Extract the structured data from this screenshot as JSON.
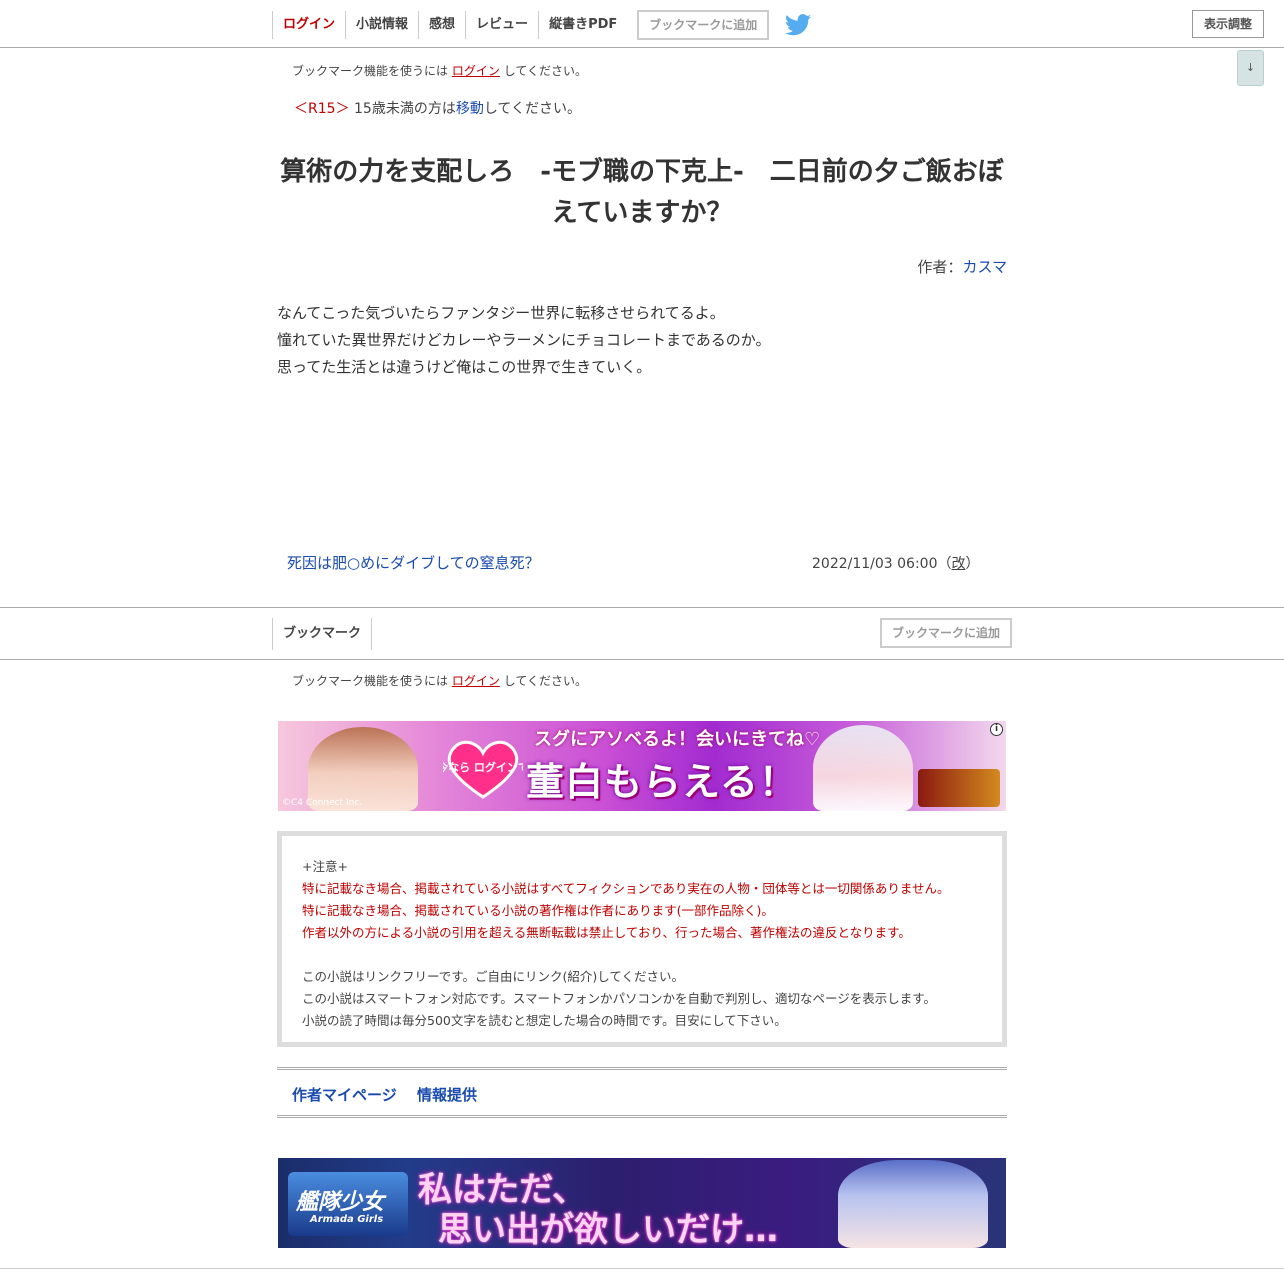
{
  "nav": {
    "items": [
      "ログイン",
      "小説情報",
      "感想",
      "レビュー",
      "縦書きPDF"
    ],
    "bookmark_add": "ブックマークに追加",
    "display_settings": "表示調整",
    "scroll_arrow": "↓"
  },
  "bookmark_notice": {
    "prefix": "ブックマーク機能を使うには",
    "link": "ログイン",
    "suffix": "してください。"
  },
  "rating": {
    "tag": "＜R15＞",
    "text_before": "15歳未満の方は",
    "link": "移動",
    "text_after": "してください。"
  },
  "novel": {
    "title": "算術の力を支配しろ　-モブ職の下克上-　二日前の夕ご飯おぼえていますか？",
    "author_label": "作者：",
    "author_name": "カスマ",
    "synopsis": [
      "なんてこった気づいたらファンタジー世界に転移させられてるよ。",
      "憧れていた異世界だけどカレーやラーメンにチョコレートまであるのか。",
      "思ってた生活とは違うけど俺はこの世界で生きていく。"
    ]
  },
  "chapter": {
    "title": "死因は肥○めにダイブしての窒息死？",
    "date": "2022/11/03 06:00",
    "revised_open": "（",
    "revised": "改",
    "revised_close": "）"
  },
  "bookmark_bar": {
    "label": "ブックマーク",
    "add_button": "ブックマークに追加"
  },
  "ad1": {
    "top_text": "スグにアソベるよ！会いにきてね♡",
    "badge_text": "今なら ログインで",
    "big_text": "董白もらえる！",
    "copyright": "©C4 Connect Inc.",
    "info": "i"
  },
  "caution": {
    "heading": "+注意+",
    "red_lines": [
      "特に記載なき場合、掲載されている小説はすべてフィクションであり実在の人物・団体等とは一切関係ありません。",
      "特に記載なき場合、掲載されている小説の著作権は作者にあります(一部作品除く)。",
      "作者以外の方による小説の引用を超える無断転載は禁止しており、行った場合、著作権法の違反となります。"
    ],
    "lines": [
      "この小説はリンクフリーです。ご自由にリンク(紹介)してください。",
      "この小説はスマートフォン対応です。スマートフォンかパソコンかを自動で判別し、適切なページを表示します。",
      "小説の読了時間は毎分500文字を読むと想定した場合の時間です。目安にして下さい。"
    ]
  },
  "footer_links": [
    "作者マイページ",
    "情報提供"
  ],
  "ad2": {
    "logo_text": "艦隊少女",
    "logo_sub": "Armada Girls",
    "line1": "私はただ、",
    "line2": "思い出が欲しいだけ…"
  },
  "colors": {
    "link_blue": "#1a4bb0",
    "login_red": "#c00000",
    "twitter": "#55acee"
  }
}
